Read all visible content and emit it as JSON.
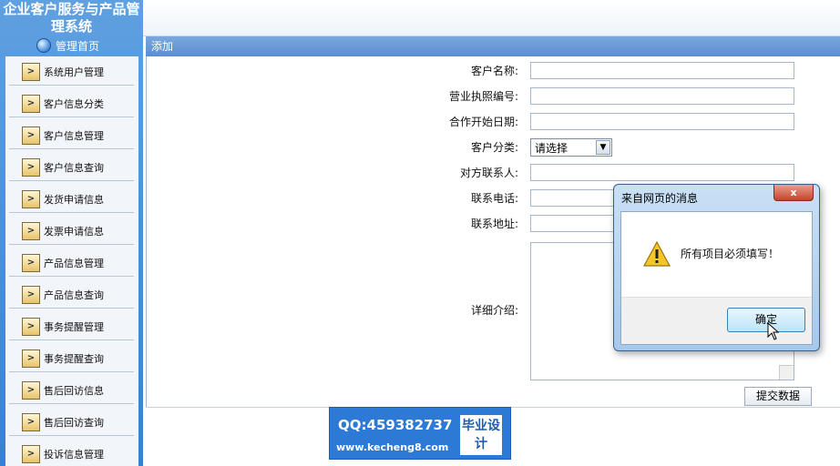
{
  "sidebar": {
    "title": "企业客户服务与产品管理系统",
    "home_label": "管理首页",
    "items": [
      {
        "label": "系统用户管理"
      },
      {
        "label": "客户信息分类"
      },
      {
        "label": "客户信息管理"
      },
      {
        "label": "客户信息查询"
      },
      {
        "label": "发货申请信息"
      },
      {
        "label": "发票申请信息"
      },
      {
        "label": "产品信息管理"
      },
      {
        "label": "产品信息查询"
      },
      {
        "label": "事务提醒管理"
      },
      {
        "label": "事务提醒查询"
      },
      {
        "label": "售后回访信息"
      },
      {
        "label": "售后回访查询"
      },
      {
        "label": "投诉信息管理"
      }
    ]
  },
  "panel": {
    "title": "添加"
  },
  "form": {
    "customer_name_label": "客户名称:",
    "license_no_label": "营业执照编号:",
    "start_date_label": "合作开始日期:",
    "category_label": "客户分类:",
    "category_selected": "请选择",
    "contact_label": "对方联系人:",
    "phone_label": "联系电话:",
    "address_label": "联系地址:",
    "detail_label": "详细介绍:",
    "submit_label": "提交数据"
  },
  "dialog": {
    "title": "来自网页的消息",
    "close_label": "x",
    "message": "所有项目必须填写！",
    "ok_label": "确定"
  },
  "watermark": {
    "qq": "QQ:459382737",
    "url": "www.kecheng8.com",
    "badge": "毕业设计"
  }
}
